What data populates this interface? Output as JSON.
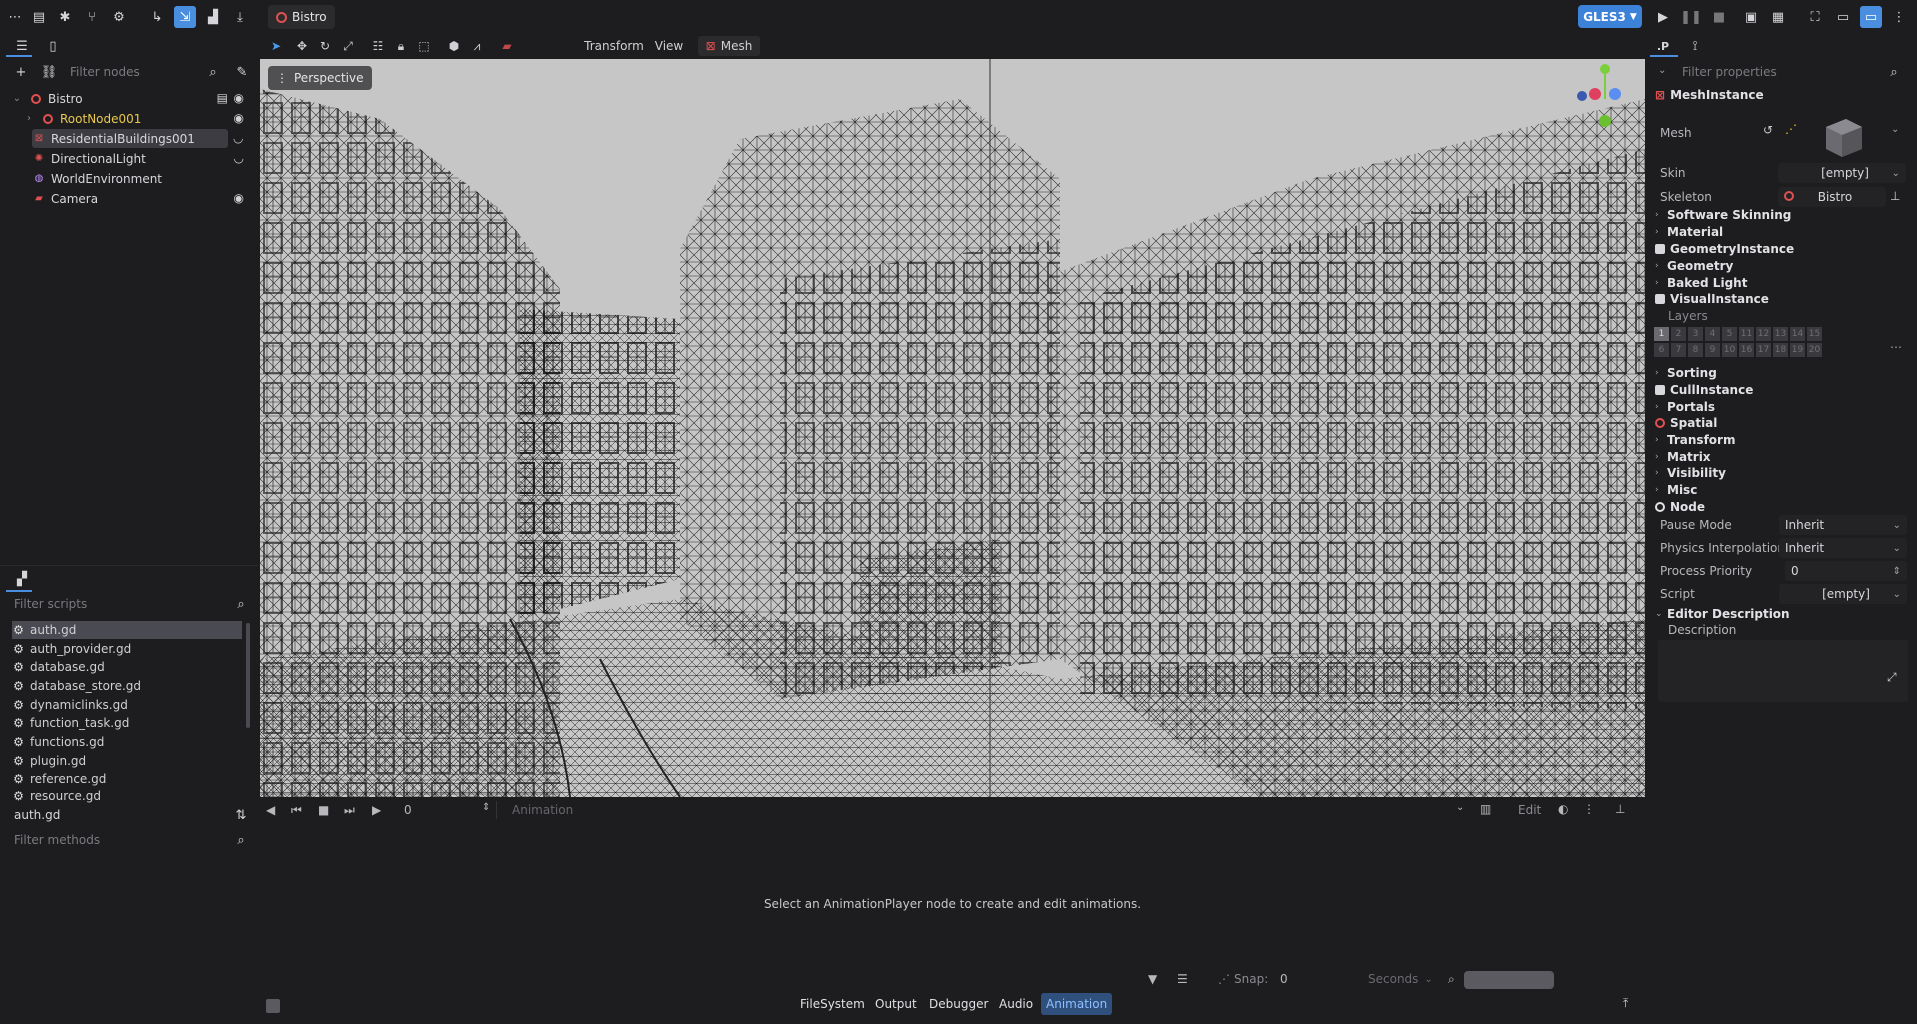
{
  "scene_tab": {
    "label": "Bistro"
  },
  "renderer": {
    "label": "GLES3"
  },
  "viewport_menu": {
    "transform": "Transform",
    "view": "View",
    "mesh": "Mesh"
  },
  "viewport": {
    "perspective_label": "Perspective"
  },
  "scene_tree": {
    "filter_placeholder": "Filter nodes",
    "nodes": [
      {
        "label": "Bistro",
        "icon": "node3d-icon"
      },
      {
        "label": "RootNode001",
        "icon": "node3d-icon"
      },
      {
        "label": "ResidentialBuildings001",
        "icon": "mesh-instance-icon"
      },
      {
        "label": "DirectionalLight",
        "icon": "light-icon"
      },
      {
        "label": "WorldEnvironment",
        "icon": "globe-icon"
      },
      {
        "label": "Camera",
        "icon": "camera-icon"
      }
    ]
  },
  "scripts": {
    "filter_placeholder": "Filter scripts",
    "items": [
      "auth.gd",
      "auth_provider.gd",
      "database.gd",
      "database_store.gd",
      "dynamiclinks.gd",
      "function_task.gd",
      "functions.gd",
      "plugin.gd",
      "reference.gd",
      "resource.gd"
    ],
    "current": "auth.gd",
    "methods_placeholder": "Filter methods"
  },
  "animation": {
    "time": "0",
    "name_placeholder": "Animation",
    "edit_label": "Edit",
    "empty_message": "Select an AnimationPlayer node to create and edit animations.",
    "snap_label": "Snap:",
    "snap_value": "0",
    "unit": "Seconds"
  },
  "bottom_tabs": [
    "FileSystem",
    "Output",
    "Debugger",
    "Audio",
    "Animation"
  ],
  "inspector": {
    "filter_placeholder": "Filter properties",
    "class_name": "MeshInstance",
    "mesh_label": "Mesh",
    "skin_label": "Skin",
    "skin_value": "[empty]",
    "skeleton_label": "Skeleton",
    "skeleton_value": "Bistro",
    "sections": [
      "Software Skinning",
      "Material",
      "GeometryInstance",
      "Geometry",
      "Baked Light",
      "VisualInstance"
    ],
    "layers_label": "Layers",
    "layers_row1": [
      "1",
      "2",
      "3",
      "4",
      "5",
      "11",
      "12",
      "13",
      "14",
      "15"
    ],
    "layers_row2": [
      "6",
      "7",
      "8",
      "9",
      "10",
      "16",
      "17",
      "18",
      "19",
      "20"
    ],
    "sections2": [
      "Sorting",
      "CullInstance",
      "Portals",
      "Spatial",
      "Transform",
      "Matrix",
      "Visibility",
      "Misc",
      "Node"
    ],
    "pause_mode_label": "Pause Mode",
    "pause_mode_value": "Inherit",
    "physics_interp_label": "Physics Interpolation",
    "physics_interp_value": "Inherit",
    "process_priority_label": "Process Priority",
    "process_priority_value": "0",
    "script_label": "Script",
    "script_value": "[empty]",
    "editor_desc_label": "Editor Description",
    "description_label": "Description"
  }
}
